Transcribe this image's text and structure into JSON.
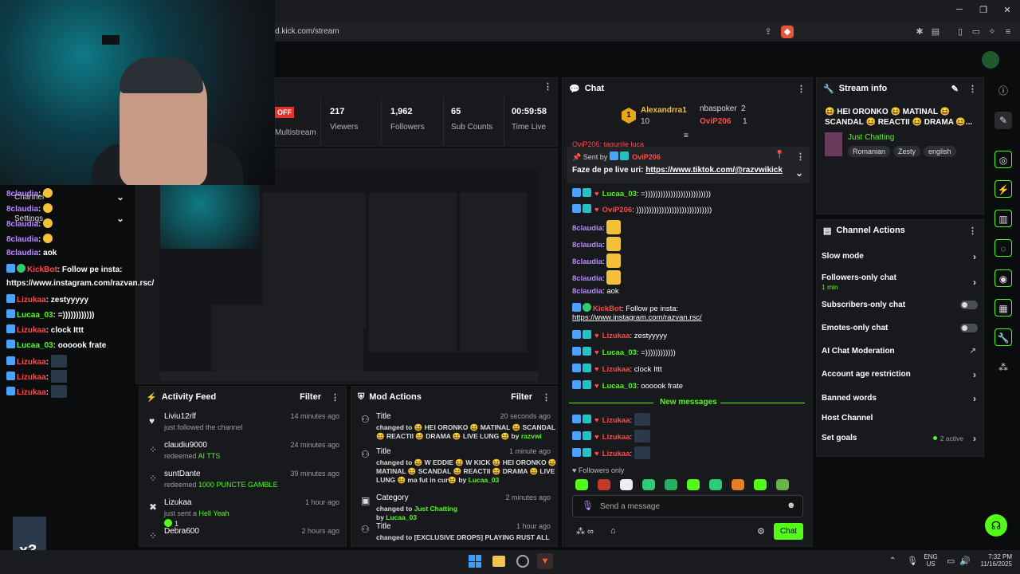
{
  "browser": {
    "url": "d.kick.com/stream",
    "win_min": "─",
    "win_max": "❐",
    "win_close": "✕"
  },
  "stats": [
    {
      "value": "217",
      "label": "Viewers"
    },
    {
      "value": "1,962",
      "label": "Followers"
    },
    {
      "value": "65",
      "label": "Sub Counts"
    },
    {
      "value": "00:59:58",
      "label": "Time Live"
    }
  ],
  "multistream": {
    "badge": "OFF",
    "label": "Multistream"
  },
  "overlay_menu": {
    "channel": "Channel",
    "settings": "Settings"
  },
  "overlay_chat": [
    {
      "user": "8claudia",
      "color": "#b78cff",
      "text": "",
      "emoji": true
    },
    {
      "user": "8claudia",
      "color": "#b78cff",
      "text": "",
      "emoji": true
    },
    {
      "user": "8claudia",
      "color": "#b78cff",
      "text": "",
      "emoji": true
    },
    {
      "user": "8claudia",
      "color": "#b78cff",
      "text": "",
      "emoji": true
    },
    {
      "user": "8claudia",
      "color": "#b78cff",
      "text": "aok"
    },
    {
      "user": "KickBot",
      "color": "#ff4b4b",
      "text": "Follow pe insta:"
    },
    {
      "user": "",
      "color": "#ffffff",
      "text": "https://www.instagram.com/razvan.rsc/"
    },
    {
      "user": "Lizukaa",
      "color": "#ff4b4b",
      "text": "zestyyyyy"
    },
    {
      "user": "Lucaa_03",
      "color": "#53fc18",
      "text": "=))))))))))))"
    },
    {
      "user": "Lizukaa",
      "color": "#ff4b4b",
      "text": "clock Ittt"
    },
    {
      "user": "Lucaa_03",
      "color": "#53fc18",
      "text": "oooook frate"
    },
    {
      "user": "Lizukaa",
      "color": "#ff4b4b",
      "text": "",
      "thumb": true
    },
    {
      "user": "Lizukaa",
      "color": "#ff4b4b",
      "text": "",
      "thumb": true
    },
    {
      "user": "Lizukaa",
      "color": "#ff4b4b",
      "text": "",
      "thumb": true
    }
  ],
  "sub_multiplier": "x3",
  "activity_feed": {
    "title": "Activity Feed",
    "filter": "Filter",
    "items": [
      {
        "user": "Liviu12rlf",
        "time": "14 minutes ago",
        "action": "just followed the channel",
        "highlight": ""
      },
      {
        "user": "claudiu9000",
        "time": "24 minutes ago",
        "action": "redeemed",
        "highlight": "AI TTS"
      },
      {
        "user": "suntDante",
        "time": "39 minutes ago",
        "action": "redeemed",
        "highlight": "1000 PUNCTE GAMBLE"
      },
      {
        "user": "Lizukaa",
        "time": "1 hour ago",
        "action": "just sent a",
        "highlight": "Hell Yeah",
        "count": "1"
      },
      {
        "user": "Debra600",
        "time": "2 hours ago",
        "action": "",
        "highlight": ""
      }
    ]
  },
  "mod_actions": {
    "title": "Mod Actions",
    "filter": "Filter",
    "items": [
      {
        "title": "Title",
        "time": "20 seconds ago",
        "line1": "changed to 😆 HEI ORONKO 😆 MATINAL 😆 SCANDAL",
        "line2": "😆 REACTII 😆 DRAMA 😆 LIVE LUNG 😆 by",
        "by": "razvwi"
      },
      {
        "title": "Title",
        "time": "1 minute ago",
        "line1": "changed to 😆 W EDDIE 😆 W KICK 😆 HEI ORONKO 😆",
        "line2": "MATINAL 😆 SCANDAL 😆 REACTII 😆 DRAMA 😆 LIVE",
        "line3": "LUNG 😆 ma fut in cur😆 by",
        "by": "Lucaa_03"
      },
      {
        "title": "Category",
        "time": "2 minutes ago",
        "line1": "changed to",
        "cat": "Just Chatting",
        "line2": "by",
        "by": "Lucaa_03"
      },
      {
        "title": "Title",
        "time": "1 hour ago",
        "line1": "changed to [EXCLUSIVE DROPS] PLAYING RUST ALL"
      }
    ]
  },
  "chat": {
    "title": "Chat",
    "top_gifters": [
      {
        "name": "Alexandrra1",
        "count": "10",
        "rank": "1"
      },
      {
        "name": "nbaspoker",
        "count": "2"
      },
      {
        "name": "OviP206",
        "count": "1"
      }
    ],
    "pinned": {
      "sent_by": "Sent by",
      "user": "OviP206",
      "text": "Faze de pe live uri:",
      "link": "https://www.tiktok.com/@razvwikick"
    },
    "partial_top": "OviP206: taguriile luca",
    "messages": [
      {
        "user": "Lucaa_03",
        "color": "#53fc18",
        "text": "=))))))))))))))))))))))))))"
      },
      {
        "user": "OviP206",
        "color": "#ff4b4b",
        "text": "))))))))))))))))))))))))))))))"
      },
      {
        "user": "8claudia",
        "color": "#b78cff",
        "text": "",
        "emoji": true
      },
      {
        "user": "8claudia",
        "color": "#b78cff",
        "text": "",
        "emoji": true
      },
      {
        "user": "8claudia",
        "color": "#b78cff",
        "text": "",
        "emoji": true
      },
      {
        "user": "8claudia",
        "color": "#b78cff",
        "text": "",
        "emoji": true
      },
      {
        "user": "8claudia",
        "color": "#b78cff",
        "text": "aok"
      },
      {
        "user": "KickBot",
        "color": "#ff4b4b",
        "text": "Follow pe insta:",
        "link": "https://www.instagram.com/razvan.rsc/"
      },
      {
        "user": "Lizukaa",
        "color": "#ff4b4b",
        "text": "zestyyyyy"
      },
      {
        "user": "Lucaa_03",
        "color": "#53fc18",
        "text": "=))))))))))))"
      },
      {
        "user": "Lizukaa",
        "color": "#ff4b4b",
        "text": "clock Ittt"
      },
      {
        "user": "Lucaa_03",
        "color": "#53fc18",
        "text": "oooook frate"
      }
    ],
    "new_messages": "New messages",
    "new_msgs": [
      {
        "user": "Lizukaa",
        "color": "#ff4b4b"
      },
      {
        "user": "Lizukaa",
        "color": "#ff4b4b"
      },
      {
        "user": "Lizukaa",
        "color": "#ff4b4b"
      }
    ],
    "followers_only": "Followers only",
    "input_placeholder": "Send a message",
    "send_label": "Chat"
  },
  "stream_info": {
    "title": "Stream info",
    "stream_title_line1": "😆 HEI ORONKO 😆 MATINAL 😆",
    "stream_title_line2": "SCANDAL 😆 REACTII 😆 DRAMA 😆...",
    "category": "Just Chatting",
    "tags": [
      "Romanian",
      "Zesty",
      "english"
    ]
  },
  "channel_actions": {
    "title": "Channel Actions",
    "items": [
      {
        "label": "Slow mode",
        "control": "chevron"
      },
      {
        "label": "Followers-only chat",
        "sub": "1 min",
        "control": "chevron"
      },
      {
        "label": "Subscribers-only chat",
        "control": "toggle"
      },
      {
        "label": "Emotes-only chat",
        "control": "toggle"
      },
      {
        "label": "AI Chat Moderation",
        "control": "external"
      },
      {
        "label": "Account age restriction",
        "control": "chevron"
      },
      {
        "label": "Banned words",
        "control": "chevron"
      },
      {
        "label": "Host Channel",
        "control": "none"
      },
      {
        "label": "Set goals",
        "status": "2 active",
        "control": "chevron"
      }
    ]
  },
  "taskbar": {
    "lang": "ENG",
    "region": "US",
    "time": "7:32 PM",
    "date": "11/16/2025"
  },
  "colors": {
    "accent": "#53fc18",
    "panel": "#18191c",
    "bg": "#0b0c0e"
  }
}
